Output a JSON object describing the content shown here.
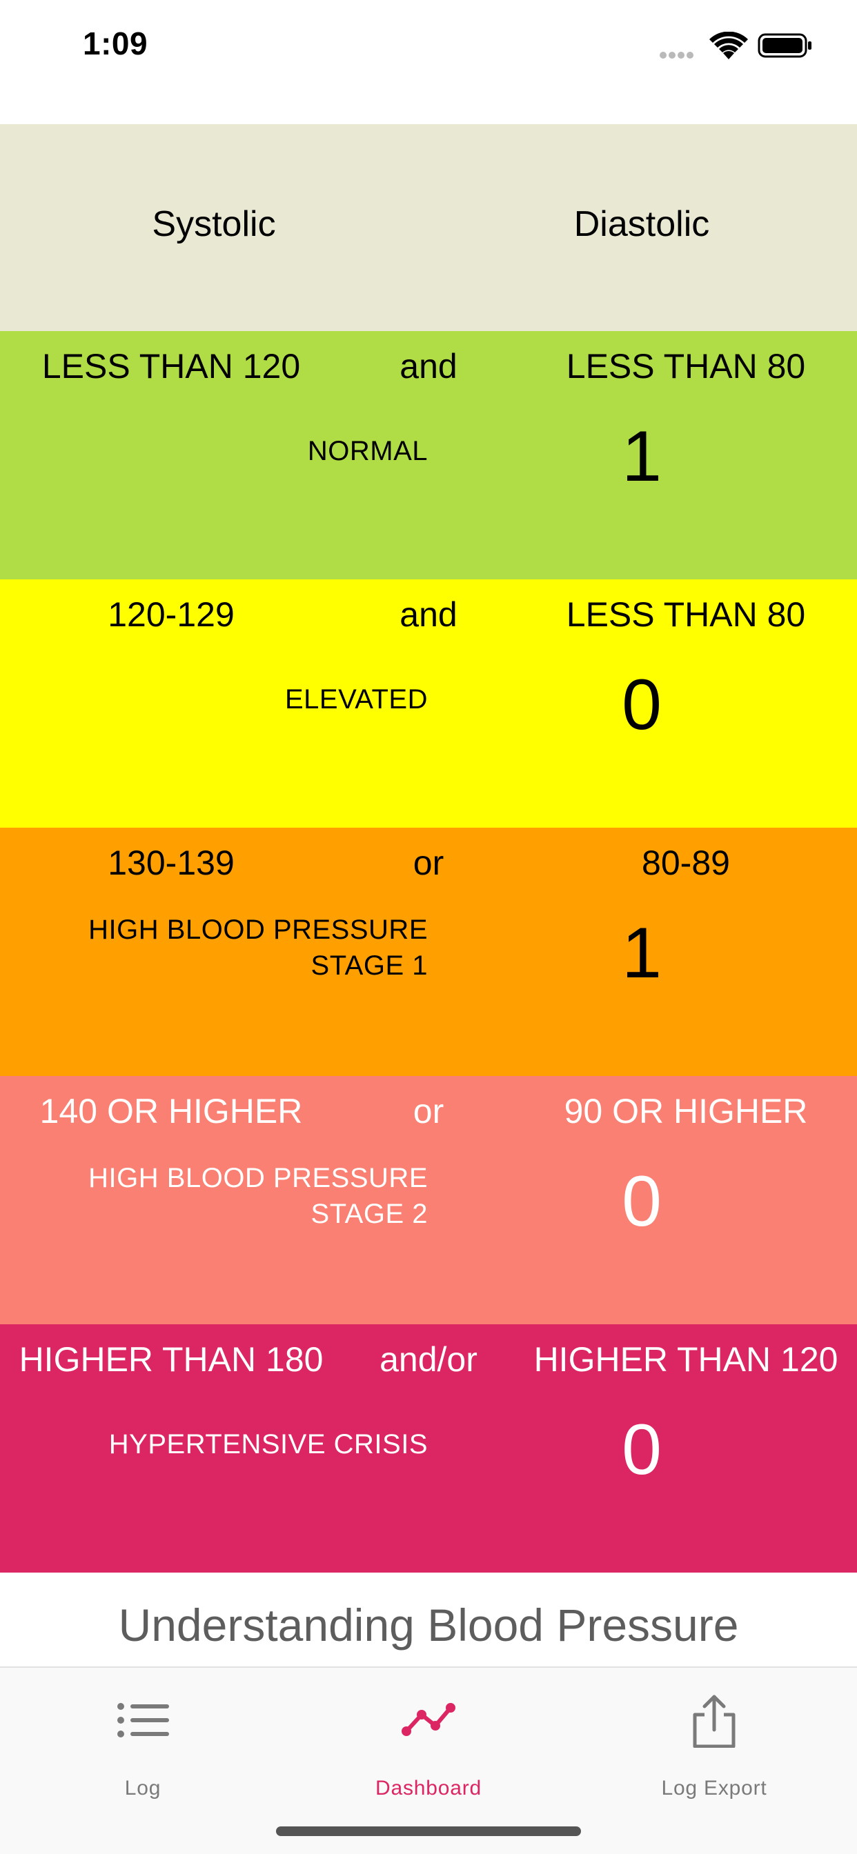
{
  "status_bar": {
    "time": "1:09"
  },
  "header": {
    "systolic": "Systolic",
    "diastolic": "Diastolic"
  },
  "categories": [
    {
      "systolic": "LESS THAN 120",
      "operator": "and",
      "diastolic": "LESS THAN 80",
      "name": "NORMAL",
      "count": "1",
      "color": "#b0dd46"
    },
    {
      "systolic": "120-129",
      "operator": "and",
      "diastolic": "LESS THAN 80",
      "name": "ELEVATED",
      "count": "0",
      "color": "#ffff00"
    },
    {
      "systolic": "130-139",
      "operator": "or",
      "diastolic": "80-89",
      "name_line1": "HIGH BLOOD PRESSURE",
      "name_line2": "STAGE 1",
      "count": "1",
      "color": "#ffa000"
    },
    {
      "systolic": "140 OR HIGHER",
      "operator": "or",
      "diastolic": "90 OR HIGHER",
      "name_line1": "HIGH BLOOD PRESSURE",
      "name_line2": "STAGE 2",
      "count": "0",
      "color": "#f98073"
    },
    {
      "systolic": "HIGHER THAN 180",
      "operator": "and/or",
      "diastolic": "HIGHER THAN 120",
      "name": "HYPERTENSIVE CRISIS",
      "count": "0",
      "color": "#dc2563"
    }
  ],
  "section_title": "Understanding Blood Pressure",
  "tabs": [
    {
      "label": "Log",
      "icon": "list-icon",
      "active": false
    },
    {
      "label": "Dashboard",
      "icon": "chart-line-icon",
      "active": true
    },
    {
      "label": "Log Export",
      "icon": "share-icon",
      "active": false
    }
  ],
  "colors": {
    "accent": "#dc2563",
    "inactive_tab": "#7a7a7a"
  }
}
